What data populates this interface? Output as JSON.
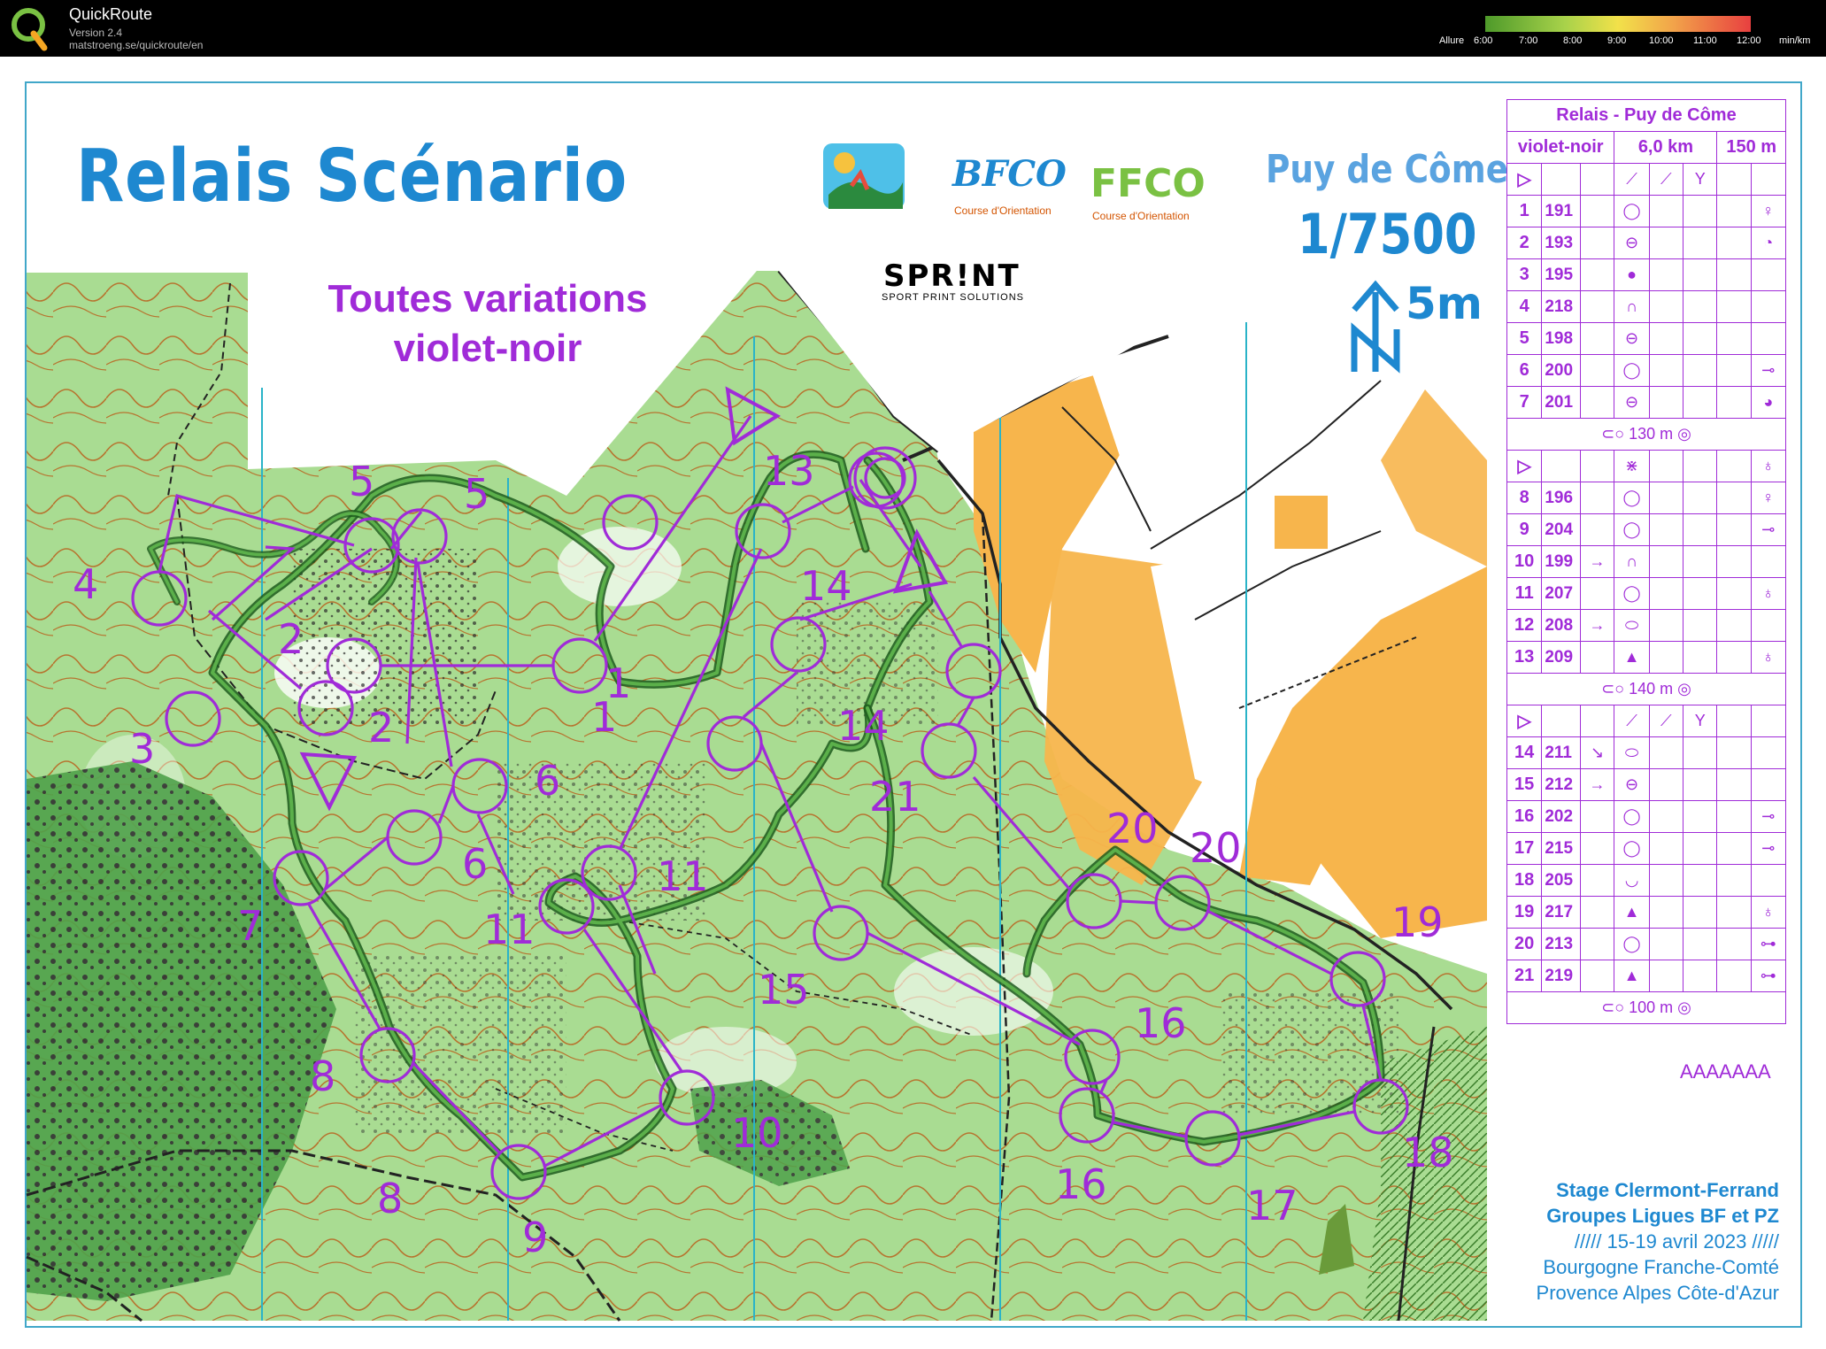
{
  "app": {
    "title": "QuickRoute",
    "version": "Version 2.4",
    "url": "matstroeng.se/quickroute/en",
    "pace_label": "Allure",
    "pace_ticks": [
      "6:00",
      "7:00",
      "8:00",
      "9:00",
      "10:00",
      "11:00",
      "12:00"
    ],
    "pace_unit": "min/km"
  },
  "map": {
    "title": "Relais Scénario",
    "variations_line1": "Toutes variations",
    "variations_line2": "violet-noir",
    "place": "Puy de Côme",
    "scale": "1/7500",
    "equidistance": "5m",
    "sponsor_name": "SPR!NT",
    "sponsor_sub": "SPORT PRINT SOLUTIONS",
    "logo2_text": "BFCO",
    "logo2_sub": "Course d'Orientation",
    "logo3_text": "FFCO",
    "logo3_sub": "Course d'Orientation",
    "footer_code": "AAAAAAA",
    "stage_line1": "Stage Clermont-Ferrand",
    "stage_line2": "Groupes Ligues BF et PZ",
    "stage_line3": "///// 15-19 avril 2023 /////",
    "stage_line4": "Bourgogne Franche-Comté",
    "stage_line5": "Provence Alpes Côte-d'Azur"
  },
  "description": {
    "event": "Relais - Puy de Côme",
    "course": "violet-noir",
    "distance": "6,0 km",
    "climb": "150 m",
    "block1": [
      {
        "n": "1",
        "code": "191"
      },
      {
        "n": "2",
        "code": "193"
      },
      {
        "n": "3",
        "code": "195"
      },
      {
        "n": "4",
        "code": "218"
      },
      {
        "n": "5",
        "code": "198"
      },
      {
        "n": "6",
        "code": "200"
      },
      {
        "n": "7",
        "code": "201"
      }
    ],
    "leg1": "130 m",
    "block2": [
      {
        "n": "8",
        "code": "196"
      },
      {
        "n": "9",
        "code": "204"
      },
      {
        "n": "10",
        "code": "199"
      },
      {
        "n": "11",
        "code": "207"
      },
      {
        "n": "12",
        "code": "208"
      },
      {
        "n": "13",
        "code": "209"
      }
    ],
    "leg2": "140 m",
    "block3": [
      {
        "n": "14",
        "code": "211"
      },
      {
        "n": "15",
        "code": "212"
      },
      {
        "n": "16",
        "code": "202"
      },
      {
        "n": "17",
        "code": "215"
      },
      {
        "n": "18",
        "code": "205"
      },
      {
        "n": "19",
        "code": "217"
      },
      {
        "n": "20",
        "code": "213"
      },
      {
        "n": "21",
        "code": "219"
      }
    ],
    "leg3": "100 m"
  },
  "control_labels": [
    "1",
    "1",
    "2",
    "2",
    "3",
    "4",
    "5",
    "5",
    "6",
    "6",
    "7",
    "8",
    "8",
    "9",
    "10",
    "11",
    "11",
    "13",
    "14",
    "14",
    "15",
    "16",
    "16",
    "17",
    "18",
    "19",
    "20",
    "20",
    "21"
  ],
  "colors": {
    "course": "#a02bd8",
    "title_blue": "#1e88d0",
    "open_land": "#f7b54c",
    "forest": "#8fd17c",
    "frame": "#41a7c9"
  }
}
